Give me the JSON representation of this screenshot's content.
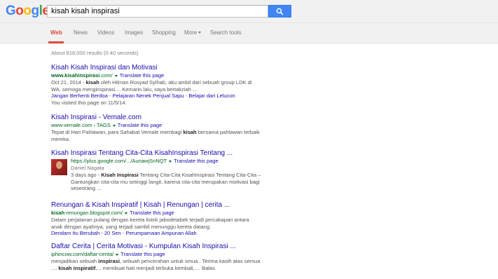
{
  "header": {
    "logo": [
      "G",
      "o",
      "o",
      "g",
      "l",
      "e"
    ],
    "logo_colors": [
      "#4285f4",
      "#ea4335",
      "#fbbc05",
      "#4285f4",
      "#34a853",
      "#ea4335"
    ],
    "query": "kisah kisah inspirasi",
    "search_button_icon": "search-icon"
  },
  "nav": {
    "web": "Web",
    "news": "News",
    "videos": "Videos",
    "images": "Images",
    "shopping": "Shopping",
    "more": "More",
    "search_tools": "Search tools"
  },
  "stats": "About 818,000 results (0.40 seconds)",
  "translate_label": "Translate this page",
  "results": [
    {
      "title": "Kisah Kisah Inspirasi dan Motivasi",
      "url_bold": "www.kisahinspirasi",
      "url_rest": ".com/",
      "snippet_date": "Oct 21, 2014 - ",
      "snippet_b1": "kisah",
      "snippet_rest": " oleh Hilman Rosyad Syihab, aku ambil dari sebuah group LDK di WA, semoga menginspirasi.... Kemarin lalu, saya bertakziah ...",
      "sitelinks": [
        "Jangan Berhenti Berdoa",
        "Pelajaran Nenek Penjual Sapu",
        "Belajar dari Lelucon"
      ],
      "sitelink_sep": " - ",
      "visited": "You visited this page on 11/5/14."
    },
    {
      "title": "Kisah Inspirasi - Vemale.com",
      "url_plain": "www.vemale.com",
      "url_crumb": " › TAGS",
      "snippet_pre": "Tepat di Hari Pahlawan, para Sahabat Vemale membagi ",
      "snippet_b1": "kisah",
      "snippet_post": " bersama pahlawan terbaik mereka."
    },
    {
      "title": "Kisah Inspirasi Tentang Cita-Cita KisahInspirasi Tentang ...",
      "url_plain": "https://plus.google.com/.../AunawjSnNQT",
      "author": "Daniel Nagata",
      "snippet_date": "3 days ago - ",
      "snippet_b1": "Kisah Inspirasi",
      "snippet_rest": " Tentang Cita-Cita KisahInspirasi Tentang Cita-Cita – Gantungkan cita-cita mu setinggi langit, karena cita-cita merupakan motivasi bagi seseorang ..."
    },
    {
      "title": "Renungan & Kisah Inspiratif | Kisah | Renungan | cerita ...",
      "url_bold": "kisah",
      "url_rest": "-renungan.blogspot.com/",
      "snippet_rest": "Dalam perjalanan pulang dengan kereta listrik jabodetabek terjadi percakapan antara anak dengan ayahnya, yang terjadi sambil menunggu kereta datang.",
      "sitelinks": [
        "Dendam Itu Berubah",
        "20 Sen",
        "Perumpamaan Ampunan Allah"
      ],
      "sitelink_sep": " - "
    },
    {
      "title": "Daftar Cerita | Cerita Motivasi - Kumpulan Kisah Inspirasi ...",
      "url_plain": "iphincow.com/daftar-cerita/",
      "snippet_pre": "menjadikan sebuah ",
      "snippet_b1": "inspirasi",
      "snippet_mid": ", sebuah pencerahan untuk smua.. Terima kasih atas semua .... ",
      "snippet_b2": "kisah inspiratif",
      "snippet_post": ",... membuat hati menjadi terbuka kembali,.... Balas."
    }
  ]
}
